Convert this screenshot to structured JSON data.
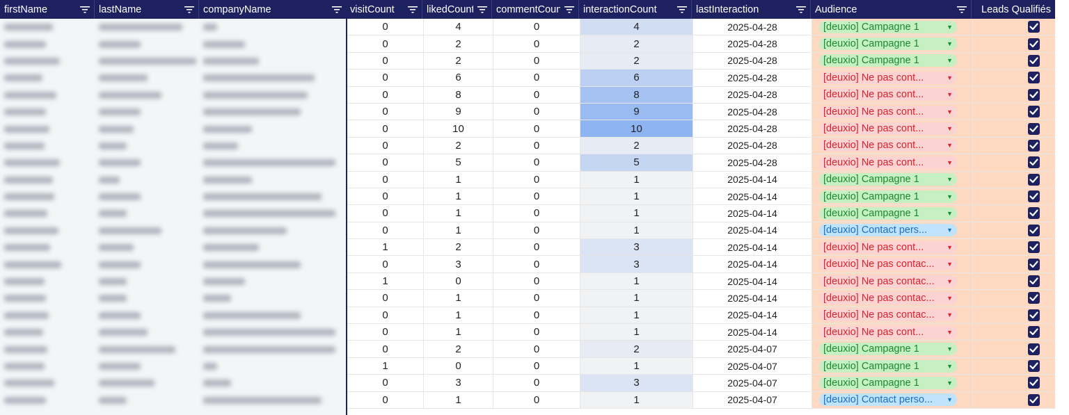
{
  "columns": [
    {
      "label": "firstName"
    },
    {
      "label": "lastName"
    },
    {
      "label": "companyName"
    },
    {
      "label": "visitCount"
    },
    {
      "label": "likedCount"
    },
    {
      "label": "commentCount"
    },
    {
      "label": "interactionCount"
    },
    {
      "label": "lastInteraction"
    },
    {
      "label": "Audience"
    },
    {
      "label": "Leads Qualifiés"
    }
  ],
  "colors": {
    "header_bg": "#1e2160",
    "chip_green": "#c6f0c4",
    "chip_red": "#fbd3d3",
    "chip_blue": "#bfe3fb",
    "audience_bg": "#fcd9c0",
    "heat_max": "#8fb4f2"
  },
  "rows": [
    {
      "visit": "0",
      "liked": "4",
      "comment": "0",
      "interaction": "4",
      "last": "2025-04-28",
      "audience": "[deuxio] Campagne 1",
      "aud_type": "green",
      "qualified": true
    },
    {
      "visit": "0",
      "liked": "2",
      "comment": "0",
      "interaction": "2",
      "last": "2025-04-28",
      "audience": "[deuxio] Campagne 1",
      "aud_type": "green",
      "qualified": true
    },
    {
      "visit": "0",
      "liked": "2",
      "comment": "0",
      "interaction": "2",
      "last": "2025-04-28",
      "audience": "[deuxio] Campagne 1",
      "aud_type": "green",
      "qualified": true
    },
    {
      "visit": "0",
      "liked": "6",
      "comment": "0",
      "interaction": "6",
      "last": "2025-04-28",
      "audience": "[deuxio] Ne pas cont...",
      "aud_type": "red",
      "qualified": true
    },
    {
      "visit": "0",
      "liked": "8",
      "comment": "0",
      "interaction": "8",
      "last": "2025-04-28",
      "audience": "[deuxio] Ne pas cont...",
      "aud_type": "red",
      "qualified": true
    },
    {
      "visit": "0",
      "liked": "9",
      "comment": "0",
      "interaction": "9",
      "last": "2025-04-28",
      "audience": "[deuxio] Ne pas cont...",
      "aud_type": "red",
      "qualified": true
    },
    {
      "visit": "0",
      "liked": "10",
      "comment": "0",
      "interaction": "10",
      "last": "2025-04-28",
      "audience": "[deuxio] Ne pas cont...",
      "aud_type": "red",
      "qualified": true
    },
    {
      "visit": "0",
      "liked": "2",
      "comment": "0",
      "interaction": "2",
      "last": "2025-04-28",
      "audience": "[deuxio] Ne pas cont...",
      "aud_type": "red",
      "qualified": true
    },
    {
      "visit": "0",
      "liked": "5",
      "comment": "0",
      "interaction": "5",
      "last": "2025-04-28",
      "audience": "[deuxio] Ne pas cont...",
      "aud_type": "red",
      "qualified": true
    },
    {
      "visit": "0",
      "liked": "1",
      "comment": "0",
      "interaction": "1",
      "last": "2025-04-14",
      "audience": "[deuxio] Campagne 1",
      "aud_type": "green",
      "qualified": true
    },
    {
      "visit": "0",
      "liked": "1",
      "comment": "0",
      "interaction": "1",
      "last": "2025-04-14",
      "audience": "[deuxio] Campagne 1",
      "aud_type": "green",
      "qualified": true
    },
    {
      "visit": "0",
      "liked": "1",
      "comment": "0",
      "interaction": "1",
      "last": "2025-04-14",
      "audience": "[deuxio] Campagne 1",
      "aud_type": "green",
      "qualified": true
    },
    {
      "visit": "0",
      "liked": "1",
      "comment": "0",
      "interaction": "1",
      "last": "2025-04-14",
      "audience": "[deuxio] Contact pers...",
      "aud_type": "blue",
      "qualified": true
    },
    {
      "visit": "1",
      "liked": "2",
      "comment": "0",
      "interaction": "3",
      "last": "2025-04-14",
      "audience": "[deuxio] Ne pas cont...",
      "aud_type": "red",
      "qualified": true
    },
    {
      "visit": "0",
      "liked": "3",
      "comment": "0",
      "interaction": "3",
      "last": "2025-04-14",
      "audience": "[deuxio] Ne pas contac...",
      "aud_type": "red",
      "qualified": true
    },
    {
      "visit": "1",
      "liked": "0",
      "comment": "0",
      "interaction": "1",
      "last": "2025-04-14",
      "audience": "[deuxio] Ne pas contac...",
      "aud_type": "red",
      "qualified": true
    },
    {
      "visit": "0",
      "liked": "1",
      "comment": "0",
      "interaction": "1",
      "last": "2025-04-14",
      "audience": "[deuxio] Ne pas contac...",
      "aud_type": "red",
      "qualified": true
    },
    {
      "visit": "0",
      "liked": "1",
      "comment": "0",
      "interaction": "1",
      "last": "2025-04-14",
      "audience": "[deuxio] Ne pas contac...",
      "aud_type": "red",
      "qualified": true
    },
    {
      "visit": "0",
      "liked": "1",
      "comment": "0",
      "interaction": "1",
      "last": "2025-04-14",
      "audience": "[deuxio] Ne pas cont...",
      "aud_type": "red",
      "qualified": true
    },
    {
      "visit": "0",
      "liked": "2",
      "comment": "0",
      "interaction": "2",
      "last": "2025-04-07",
      "audience": "[deuxio] Campagne 1",
      "aud_type": "green",
      "qualified": true
    },
    {
      "visit": "1",
      "liked": "0",
      "comment": "0",
      "interaction": "1",
      "last": "2025-04-07",
      "audience": "[deuxio] Campagne 1",
      "aud_type": "green",
      "qualified": true
    },
    {
      "visit": "0",
      "liked": "3",
      "comment": "0",
      "interaction": "3",
      "last": "2025-04-07",
      "audience": "[deuxio] Campagne 1",
      "aud_type": "green",
      "qualified": true
    },
    {
      "visit": "0",
      "liked": "1",
      "comment": "0",
      "interaction": "1",
      "last": "2025-04-07",
      "audience": "[deuxio] Contact perso...",
      "aud_type": "blue",
      "qualified": true
    }
  ]
}
